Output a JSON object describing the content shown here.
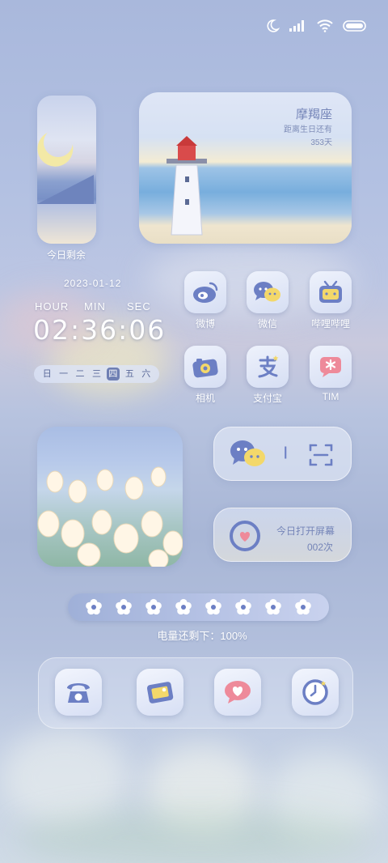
{
  "status_bar": {
    "icons": [
      "moon-icon",
      "signal-icon",
      "wifi-icon",
      "battery-icon"
    ]
  },
  "countdown_widget": {
    "label": "今日剩余"
  },
  "lighthouse_widget": {
    "sign": "摩羯座",
    "birthday_text": "距离生日还有",
    "days": "353天"
  },
  "clock": {
    "date": "2023-01-12",
    "hour_label": "HOUR",
    "min_label": "MIN",
    "sec_label": "SEC",
    "time": "02:36:06",
    "weekdays": [
      "日",
      "一",
      "二",
      "三",
      "四",
      "五",
      "六"
    ],
    "active_weekday": "四"
  },
  "apps_row1": [
    {
      "label": "微博",
      "icon": "weibo-icon"
    },
    {
      "label": "微信",
      "icon": "wechat-icon"
    },
    {
      "label": "哔哩哔哩",
      "icon": "bilibili-icon"
    }
  ],
  "apps_row2": [
    {
      "label": "相机",
      "icon": "camera-icon"
    },
    {
      "label": "支付宝",
      "icon": "alipay-icon"
    },
    {
      "label": "TIM",
      "icon": "tim-icon"
    }
  ],
  "wechat_scan_widget": {
    "separator": "|"
  },
  "screen_widget": {
    "title": "今日打开屏幕",
    "count": "002次"
  },
  "battery_widget": {
    "text": "电量还剩下：100%",
    "flower_count": 8
  },
  "dock": [
    {
      "icon": "phone-icon"
    },
    {
      "icon": "gallery-icon"
    },
    {
      "icon": "heart-message-icon"
    },
    {
      "icon": "clock-icon"
    }
  ],
  "colors": {
    "accent": "#6f7fb3",
    "icon_blue": "#6c7fc4",
    "icon_yellow": "#f3d86a",
    "icon_pink": "#ee8a9a"
  }
}
